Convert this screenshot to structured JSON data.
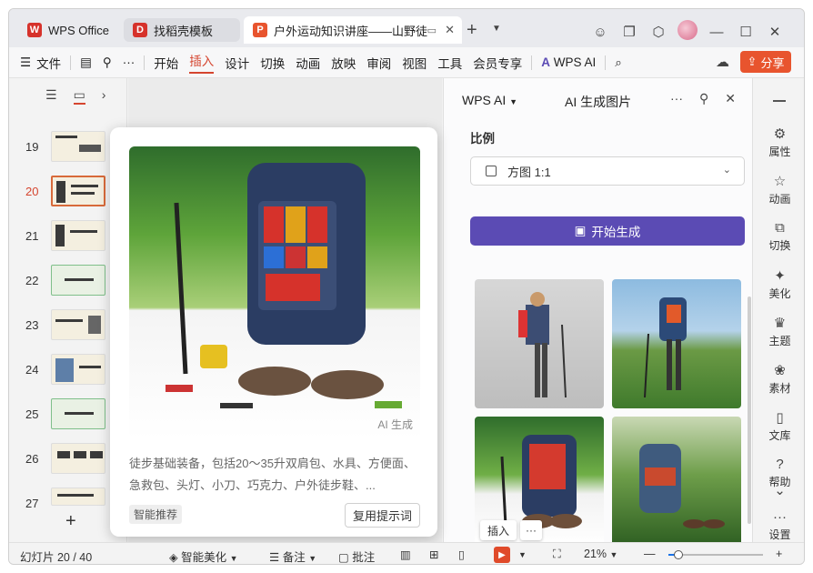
{
  "tabs": [
    {
      "label": "WPS Office",
      "color": "#d6322b",
      "icon": "wps-logo-icon"
    },
    {
      "label": "找稻壳模板",
      "color": "#d6322b",
      "icon": "docer-icon"
    },
    {
      "label": "户外运动知识讲座——山野徒",
      "color": "#e8542e",
      "icon": "ppt-file-icon"
    }
  ],
  "toolbar": {
    "file_label": "文件",
    "menu_items": [
      "开始",
      "插入",
      "设计",
      "切换",
      "动画",
      "放映",
      "审阅",
      "视图",
      "工具",
      "会员专享"
    ],
    "active_item": "插入",
    "wps_ai_label": "WPS AI",
    "share_label": "分享"
  },
  "slides": [
    {
      "num": "19"
    },
    {
      "num": "20"
    },
    {
      "num": "21"
    },
    {
      "num": "22"
    },
    {
      "num": "23"
    },
    {
      "num": "24"
    },
    {
      "num": "25"
    },
    {
      "num": "26"
    },
    {
      "num": "27"
    }
  ],
  "current_slide": "20",
  "popup": {
    "ai_tag": "AI 生成",
    "description": "徒步基础装备，包括20～35升双肩包、水具、方便面、急救包、头灯、小刀、巧克力、户外徒步鞋、...",
    "chip": "智能推荐",
    "reuse_button": "复用提示词"
  },
  "ai_panel": {
    "title": "WPS AI",
    "subtitle": "AI 生成图片",
    "ratio_label": "比例",
    "ratio_value": "方图 1:1",
    "generate_button": "开始生成",
    "insert_button": "插入",
    "more_button": "···"
  },
  "right_sidebar": [
    {
      "label": "属性",
      "icon": "sliders-icon"
    },
    {
      "label": "动画",
      "icon": "star-icon"
    },
    {
      "label": "切换",
      "icon": "transition-icon"
    },
    {
      "label": "美化",
      "icon": "magic-wand-icon"
    },
    {
      "label": "主题",
      "icon": "theme-icon"
    },
    {
      "label": "素材",
      "icon": "asset-icon"
    },
    {
      "label": "文库",
      "icon": "library-icon"
    },
    {
      "label": "帮助",
      "icon": "help-icon"
    },
    {
      "label": "设置",
      "icon": "more-icon"
    }
  ],
  "status": {
    "slide_info": "幻灯片 20 / 40",
    "smart_beautify": "智能美化",
    "notes": "备注",
    "comments": "批注",
    "zoom": "21%"
  }
}
